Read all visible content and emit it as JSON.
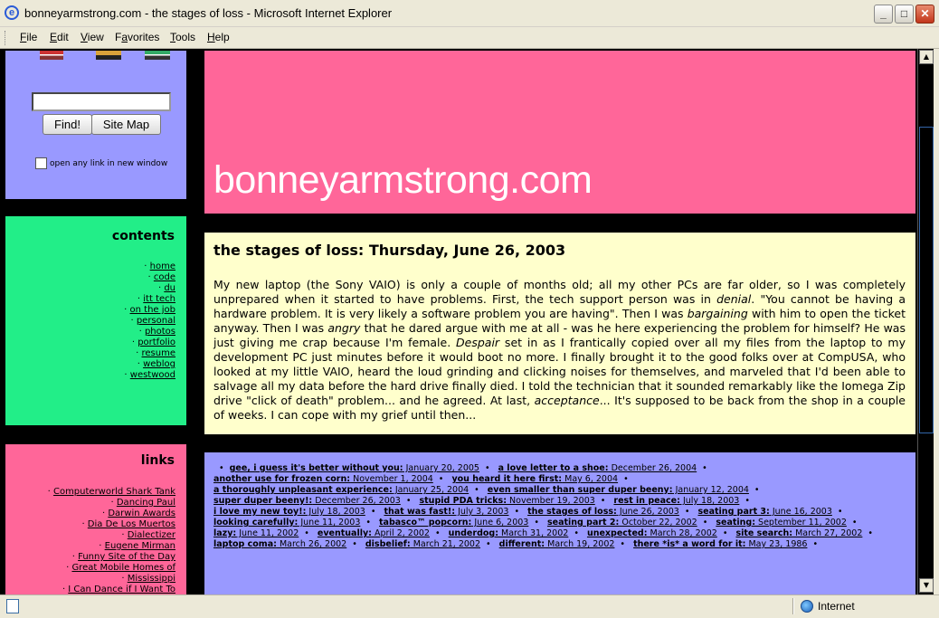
{
  "window": {
    "title": "bonneyarmstrong.com - the stages of loss - Microsoft Internet Explorer",
    "buttons": {
      "minimize": "_",
      "maximize": "□",
      "close": "✕"
    }
  },
  "menu": [
    {
      "label": "File",
      "key": "F",
      "rest": "ile"
    },
    {
      "label": "Edit",
      "key": "E",
      "rest": "dit"
    },
    {
      "label": "View",
      "key": "V",
      "rest": "iew"
    },
    {
      "label": "Favorites",
      "key": "a",
      "pre": "F",
      "rest": "vorites"
    },
    {
      "label": "Tools",
      "key": "T",
      "rest": "ools"
    },
    {
      "label": "Help",
      "key": "H",
      "rest": "elp"
    }
  ],
  "search": {
    "value": "",
    "find_label": "Find!",
    "sitemap_label": "Site Map",
    "newwin_label": "open any link in new window"
  },
  "contents": {
    "heading": "contents",
    "items": [
      "home",
      "code",
      "du",
      "itt tech",
      "on the job",
      "personal",
      "photos",
      "portfolio",
      "resume",
      "weblog",
      "westwood"
    ]
  },
  "links": {
    "heading": "links",
    "items": [
      "Computerworld Shark Tank",
      "Dancing Paul",
      "Darwin Awards",
      "Dia De Los Muertos",
      "Dialectizer",
      "Eugene Mirman",
      "Funny Site of the Day",
      "Great Mobile Homes of",
      "Mississippi",
      "I Can Dance if I Want To"
    ]
  },
  "header": {
    "site_name": "bonneyarmstrong.com"
  },
  "article": {
    "title": "the stages of loss: Thursday, June 26, 2003",
    "segments": [
      {
        "t": "My new laptop (the Sony VAIO) is only a couple of months old; all my other PCs are far older, so I was completely unprepared when it started to have problems. First, the tech support person was in "
      },
      {
        "t": "denial",
        "i": true
      },
      {
        "t": ". \"You cannot be having a hardware problem. It is very likely a software problem you are having\". Then I was "
      },
      {
        "t": "bargaining",
        "i": true
      },
      {
        "t": " with him to open the ticket anyway. Then I was "
      },
      {
        "t": "angry",
        "i": true
      },
      {
        "t": " that he dared argue with me at all - was he here experiencing the problem for himself? He was just giving me crap because I'm female. "
      },
      {
        "t": "Despair",
        "i": true
      },
      {
        "t": " set in as I frantically copied over all my files from the laptop to my development PC just minutes before it would boot no more. I finally brought it to the good folks over at CompUSA, who looked at my little VAIO, heard the loud grinding and clicking noises for themselves, and marveled that I'd been able to salvage all my data before the hard drive finally died. I told the technician that it sounded remarkably like the Iomega Zip drive \"click of death\" problem... and he agreed. At last, "
      },
      {
        "t": "acceptance",
        "i": true
      },
      {
        "t": "... It's supposed to be back from the shop in a couple of weeks. I can cope with my grief until then..."
      }
    ]
  },
  "archive": [
    {
      "title": "gee, i guess it's better without you:",
      "date": "January 20, 2005"
    },
    {
      "title": "a love letter to a shoe:",
      "date": "December 26, 2004"
    },
    {
      "title": "another use for frozen corn:",
      "date": "November 1, 2004"
    },
    {
      "title": "you heard it here first:",
      "date": "May 6, 2004"
    },
    {
      "title": "a thoroughly unpleasant experience:",
      "date": "January 25, 2004"
    },
    {
      "title": "even smaller than super duper beeny:",
      "date": "January 12, 2004"
    },
    {
      "title": "super duper beeny!:",
      "date": "December 26, 2003"
    },
    {
      "title": "stupid PDA tricks:",
      "date": "November 19, 2003"
    },
    {
      "title": "rest in peace:",
      "date": "July 18, 2003"
    },
    {
      "title": "i love my new toy!:",
      "date": "July 18, 2003"
    },
    {
      "title": "that was fast!:",
      "date": "July 3, 2003"
    },
    {
      "title": "the stages of loss:",
      "date": "June 26, 2003"
    },
    {
      "title": "seating part 3:",
      "date": "June 16, 2003"
    },
    {
      "title": "looking carefully:",
      "date": "June 11, 2003"
    },
    {
      "title": "tabasco™ popcorn:",
      "date": "June 6, 2003"
    },
    {
      "title": "seating part 2:",
      "date": "October 22, 2002"
    },
    {
      "title": "seating:",
      "date": "September 11, 2002"
    },
    {
      "title": "lazy:",
      "date": "June 11, 2002"
    },
    {
      "title": "eventually:",
      "date": "April 2, 2002"
    },
    {
      "title": "underdog:",
      "date": "March 31, 2002"
    },
    {
      "title": "unexpected:",
      "date": "March 28, 2002"
    },
    {
      "title": "site search:",
      "date": "March 27, 2002"
    },
    {
      "title": "laptop coma:",
      "date": "March 26, 2002"
    },
    {
      "title": "disbelief:",
      "date": "March 21, 2002"
    },
    {
      "title": "different:",
      "date": "March 19, 2002"
    },
    {
      "title": "there *is* a word for it:",
      "date": "May 23, 1986"
    }
  ],
  "status": {
    "zone": "Internet"
  },
  "colors": {
    "pink": "#ff6699",
    "lavender": "#9999ff",
    "green": "#22ee88",
    "cream": "#ffffcc"
  }
}
